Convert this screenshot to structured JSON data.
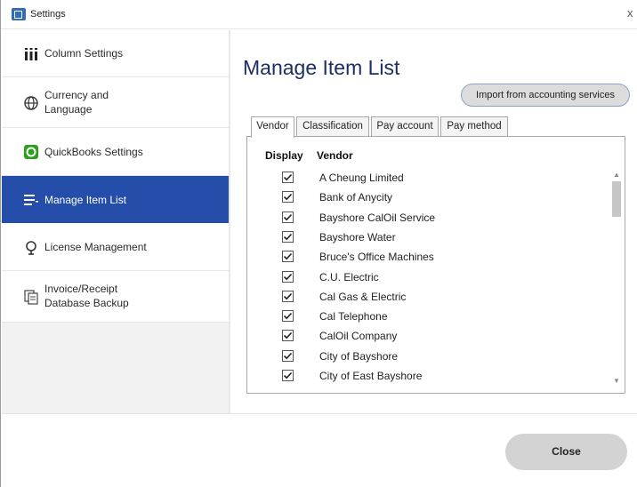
{
  "window": {
    "title": "Settings",
    "close_glyph": "x"
  },
  "sidebar": {
    "items": [
      {
        "label": "Column Settings",
        "icon": "columns-icon"
      },
      {
        "label": "Currency and Language",
        "icon": "globe-icon"
      },
      {
        "label": "QuickBooks Settings",
        "icon": "quickbooks-icon"
      },
      {
        "label": "Manage Item List",
        "icon": "list-icon",
        "active": true
      },
      {
        "label": "License Management",
        "icon": "license-icon"
      },
      {
        "label": "Invoice/Receipt Database Backup",
        "icon": "backup-icon"
      }
    ]
  },
  "main": {
    "title": "Manage Item List",
    "import_label": "Import from accounting services",
    "tabs": [
      {
        "label": "Vendor",
        "active": true
      },
      {
        "label": "Classification"
      },
      {
        "label": "Pay account"
      },
      {
        "label": "Pay method"
      }
    ],
    "table": {
      "headers": {
        "display": "Display",
        "vendor": "Vendor"
      },
      "rows": [
        {
          "checked": true,
          "vendor": "A Cheung Limited"
        },
        {
          "checked": true,
          "vendor": "Bank of Anycity"
        },
        {
          "checked": true,
          "vendor": "Bayshore CalOil Service"
        },
        {
          "checked": true,
          "vendor": "Bayshore Water"
        },
        {
          "checked": true,
          "vendor": "Bruce's Office Machines"
        },
        {
          "checked": true,
          "vendor": "C.U. Electric"
        },
        {
          "checked": true,
          "vendor": "Cal Gas & Electric"
        },
        {
          "checked": true,
          "vendor": "Cal Telephone"
        },
        {
          "checked": true,
          "vendor": "CalOil Company"
        },
        {
          "checked": true,
          "vendor": "City of Bayshore"
        },
        {
          "checked": true,
          "vendor": "City of East Bayshore"
        }
      ]
    }
  },
  "footer": {
    "close_label": "Close"
  },
  "colors": {
    "accent": "#244ea9",
    "title": "#1c2f63",
    "quickbooks_green": "#2ca01c"
  }
}
